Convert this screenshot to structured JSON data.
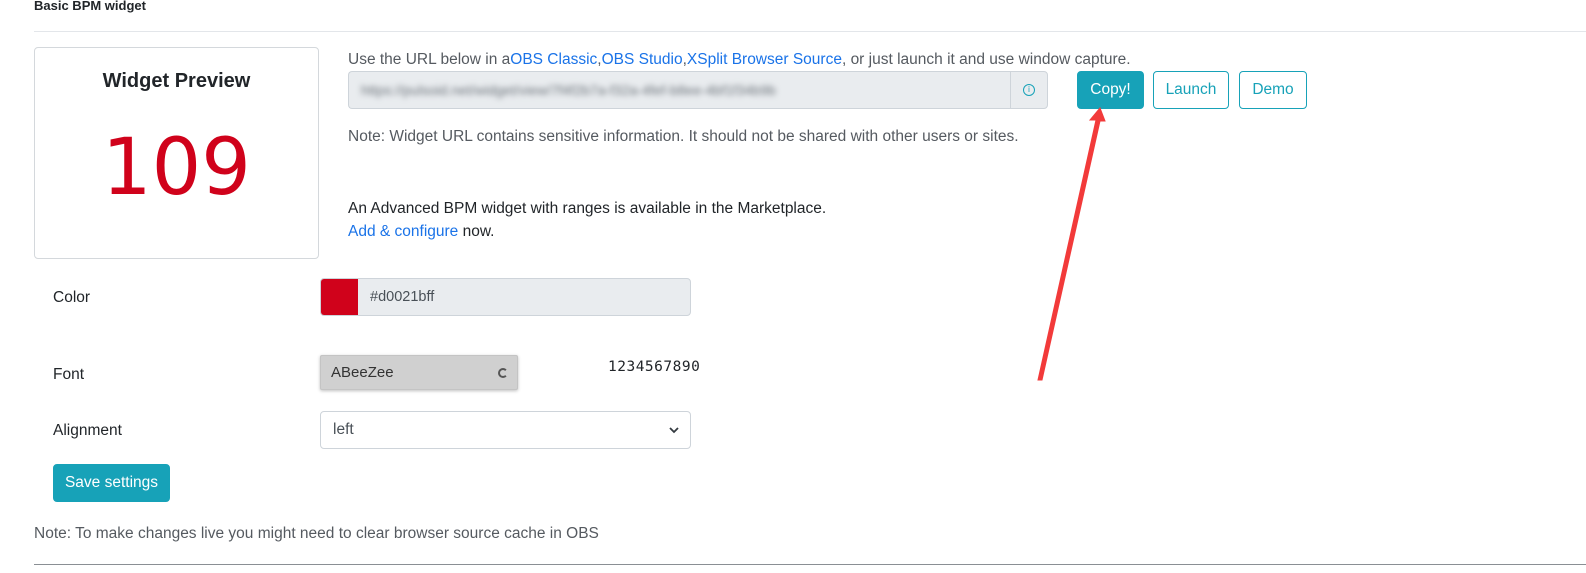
{
  "section": {
    "title": "Basic BPM widget"
  },
  "preview": {
    "title": "Widget Preview",
    "value": "109",
    "value_color": "#d0021b"
  },
  "url_section": {
    "help_prefix": "Use the URL below in a",
    "links": [
      "OBS Classic",
      "OBS Studio",
      "XSplit Browser Source"
    ],
    "help_suffix": ", or just launch it and use window capture.",
    "url_value_redacted": "https://pulsoid.net/widget/view/7f4f2b7a-f32a-4fef-b8ee-4bf1f34b9b",
    "info_icon": "info-icon",
    "note": "Note: Widget URL contains sensitive information. It should not be shared with other users or sites."
  },
  "buttons": {
    "copy": "Copy!",
    "launch": "Launch",
    "demo": "Demo",
    "save": "Save settings"
  },
  "advanced": {
    "text": "An Advanced BPM widget with ranges is available in the Marketplace.",
    "link": "Add & configure",
    "link_suffix": " now."
  },
  "form": {
    "color_label": "Color",
    "color_value": "#d0021bff",
    "color_swatch": "#d0021b",
    "font_label": "Font",
    "font_value": "ABeeZee",
    "font_sample": "1234567890",
    "alignment_label": "Alignment",
    "alignment_value": "left"
  },
  "footer_note": "Note: To make changes live you might need to clear browser source cache in OBS",
  "colors": {
    "accent": "#17a2b8",
    "link": "#1a73e8",
    "annotation_arrow": "#f23a3a"
  }
}
